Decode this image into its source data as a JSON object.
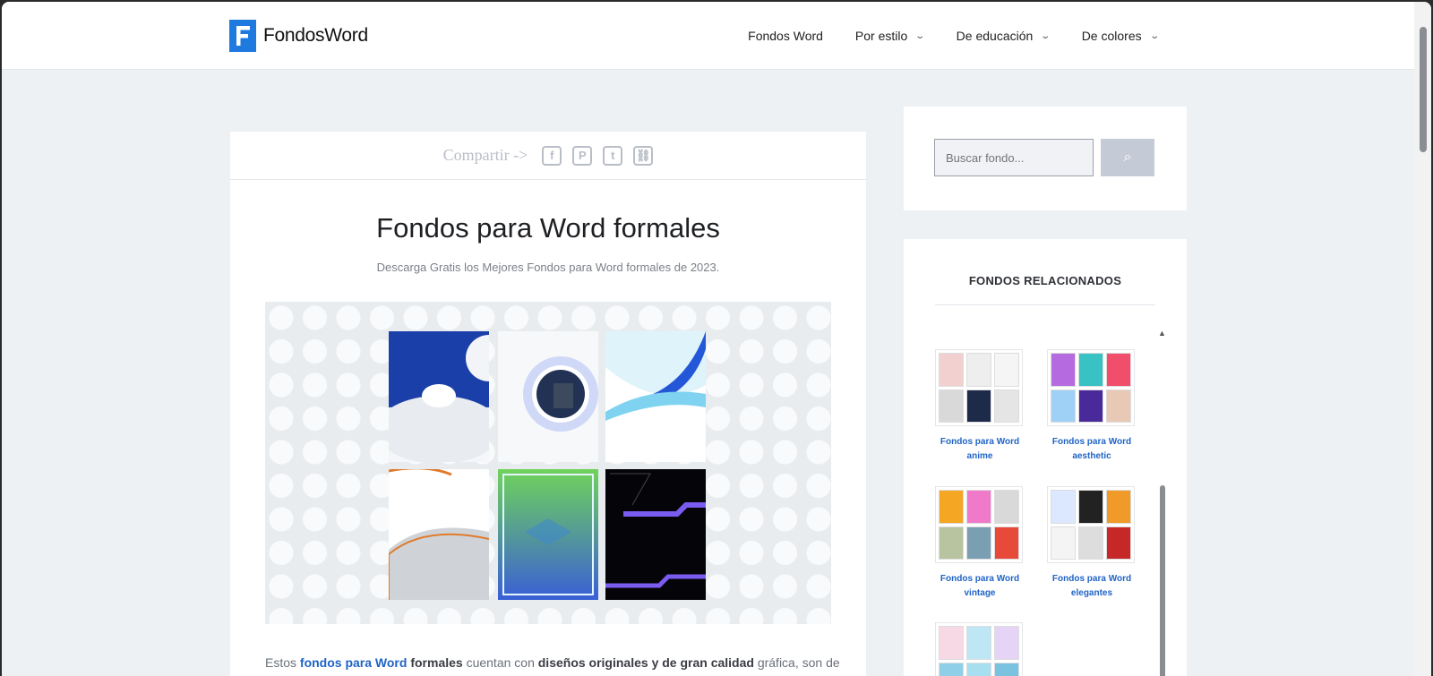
{
  "brand": {
    "name": "FondosWord"
  },
  "nav": {
    "items": [
      {
        "label": "Fondos Word",
        "dropdown": false
      },
      {
        "label": "Por estilo",
        "dropdown": true
      },
      {
        "label": "De educación",
        "dropdown": true
      },
      {
        "label": "De colores",
        "dropdown": true
      }
    ]
  },
  "share": {
    "label": "Compartir ->",
    "buttons": [
      "facebook-icon",
      "pinterest-icon",
      "tumblr-icon",
      "link-icon"
    ],
    "glyphs": [
      "f",
      "P",
      "t",
      "⛓"
    ]
  },
  "article": {
    "title": "Fondos para Word formales",
    "subtitle": "Descarga Gratis los Mejores Fondos para Word formales de 2023.",
    "intro_pre": "Estos ",
    "intro_link": "fondos para Word",
    "intro_bold1": " formales",
    "intro_mid": " cuentan con ",
    "intro_bold2": "diseños originales y de gran calidad",
    "intro_post": " gráfica, son de"
  },
  "search": {
    "placeholder": "Buscar fondo...",
    "button_icon": "search-icon",
    "button_glyph": "⌕"
  },
  "related": {
    "title": "FONDOS RELACIONADOS",
    "items": [
      {
        "line1": "Fondos para Word",
        "line2": "anime"
      },
      {
        "line1": "Fondos para Word",
        "line2": "aesthetic"
      },
      {
        "line1": "Fondos para Word",
        "line2": "vintage"
      },
      {
        "line1": "Fondos para Word",
        "line2": "elegantes"
      }
    ]
  },
  "colors": {
    "accent": "#1f7ae0",
    "link": "#1f63c6",
    "page_bg": "#eef1f4"
  }
}
